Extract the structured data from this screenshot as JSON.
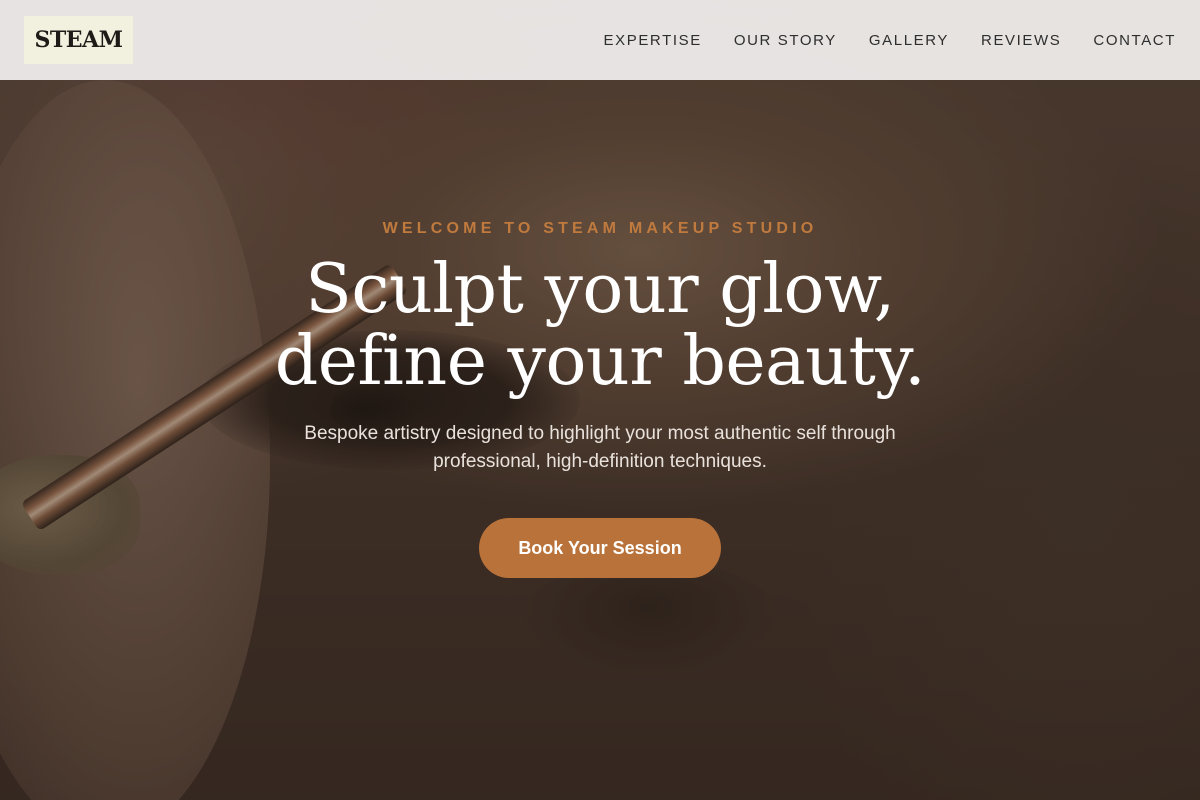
{
  "header": {
    "logo_text": "STEAM",
    "nav": [
      {
        "label": "EXPERTISE"
      },
      {
        "label": "OUR STORY"
      },
      {
        "label": "GALLERY"
      },
      {
        "label": "REVIEWS"
      },
      {
        "label": "CONTACT"
      }
    ]
  },
  "hero": {
    "eyebrow": "WELCOME TO STEAM MAKEUP STUDIO",
    "headline_line1": "Sculpt your glow,",
    "headline_line2": "define your beauty.",
    "subtext": "Bespoke artistry designed to highlight your most authentic self through professional, high-definition techniques.",
    "cta_label": "Book Your Session",
    "background_image": "close-up-eye-makeup-brush-photo"
  },
  "colors": {
    "accent": "#b9733a",
    "eyebrow": "#c07a3e",
    "header_bg": "#eceae9",
    "logo_bg": "#f2f0de"
  }
}
